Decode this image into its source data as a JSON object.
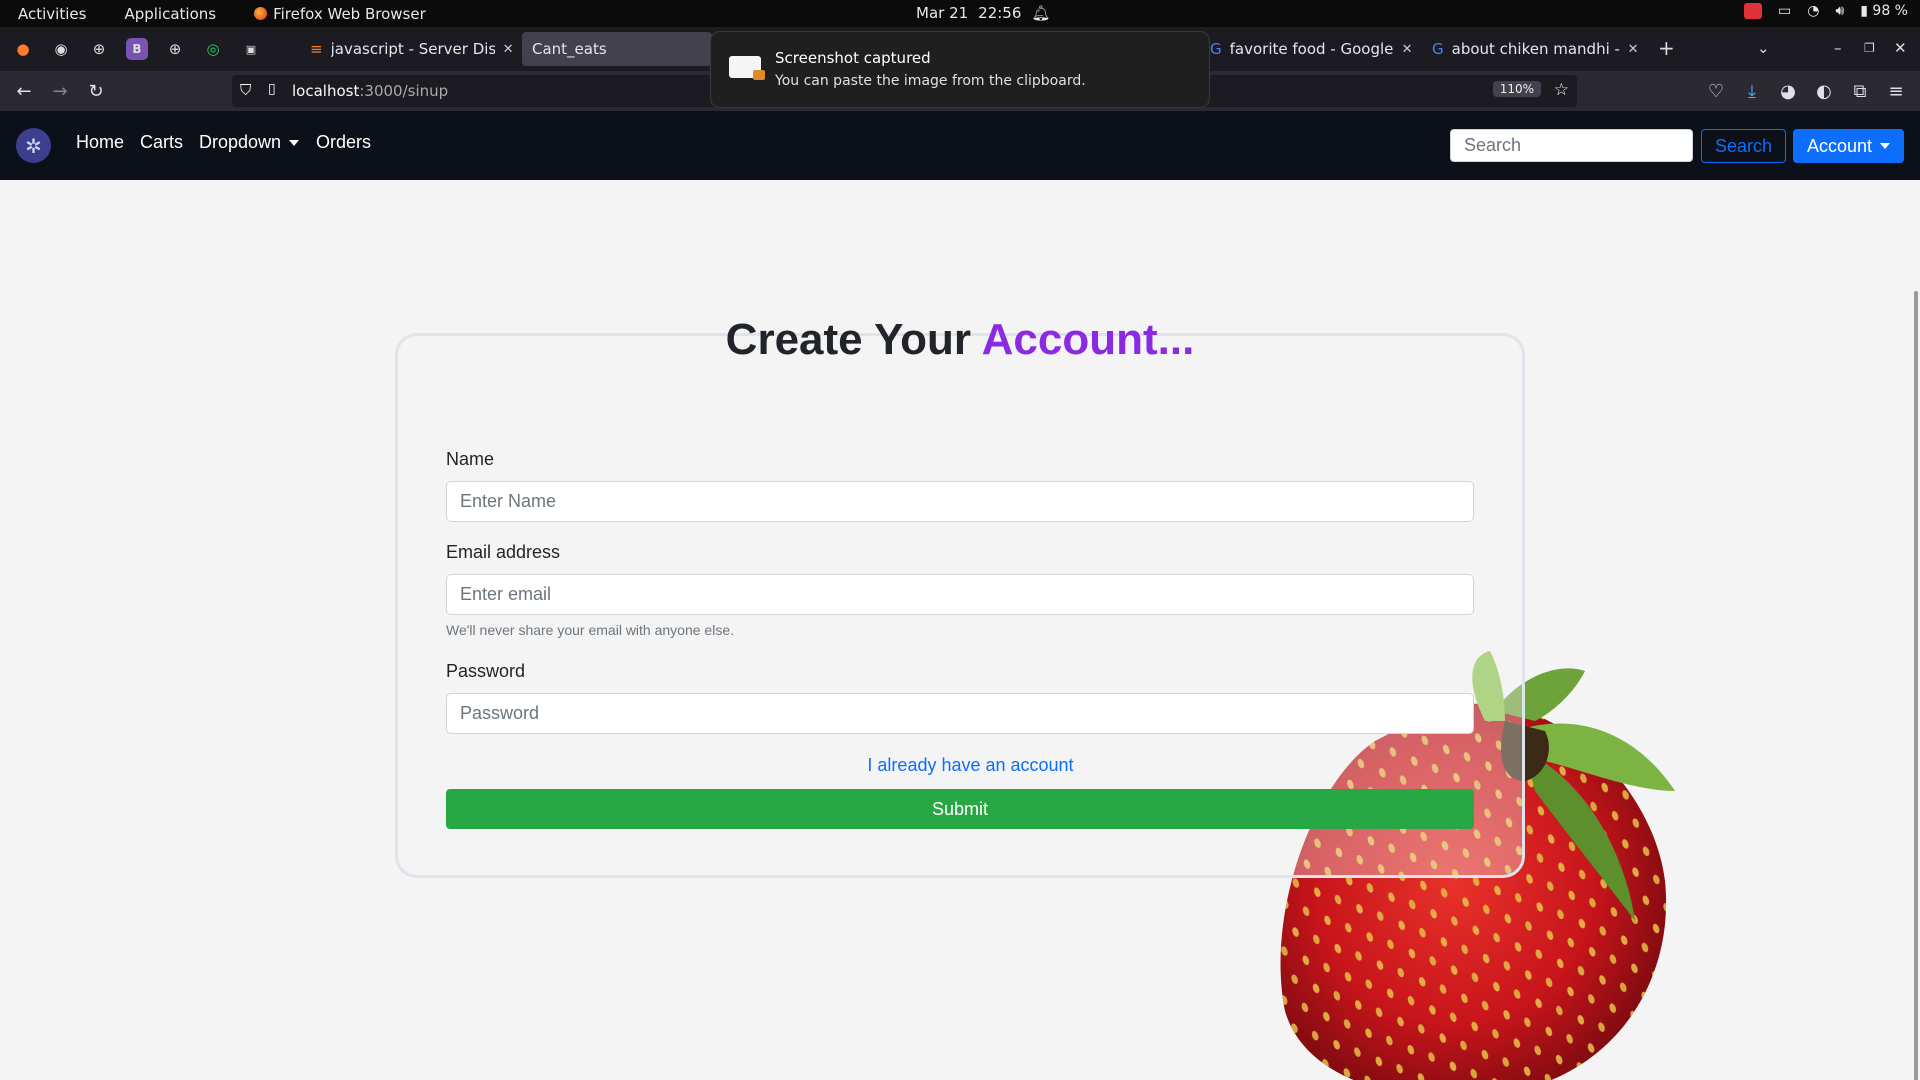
{
  "system": {
    "activities": "Activities",
    "applications": "Applications",
    "active_app": "Firefox Web Browser",
    "date": "Mar 21",
    "time": "22:56",
    "battery": "98 %"
  },
  "browser": {
    "tabs": [
      {
        "title": "javascript - Server Discov",
        "active": false
      },
      {
        "title": "Cant_eats",
        "active": true
      },
      {
        "title": "favorite food - Google Se",
        "active": false
      },
      {
        "title": "about chiken mandhi - Go",
        "active": false
      }
    ],
    "url_host": "localhost",
    "url_path": ":3000/sinup",
    "zoom": "110%"
  },
  "notification": {
    "title": "Screenshot captured",
    "body": "You can paste the image from the clipboard."
  },
  "navbar": {
    "links": [
      "Home",
      "Carts",
      "Dropdown",
      "Orders"
    ],
    "search_placeholder": "Search",
    "search_button": "Search",
    "account_button": "Account"
  },
  "form": {
    "title_main": "Create Your",
    "title_accent": "Account...",
    "name_label": "Name",
    "name_placeholder": "Enter Name",
    "email_label": "Email address",
    "email_placeholder": "Enter email",
    "email_help": "We'll never share your email with anyone else.",
    "password_label": "Password",
    "password_placeholder": "Password",
    "login_link": "I already have an account",
    "submit": "Submit"
  },
  "colors": {
    "accent": "#8a2be2",
    "primary": "#0d6efd",
    "success": "#28a745",
    "nav_bg": "#0c1119"
  }
}
